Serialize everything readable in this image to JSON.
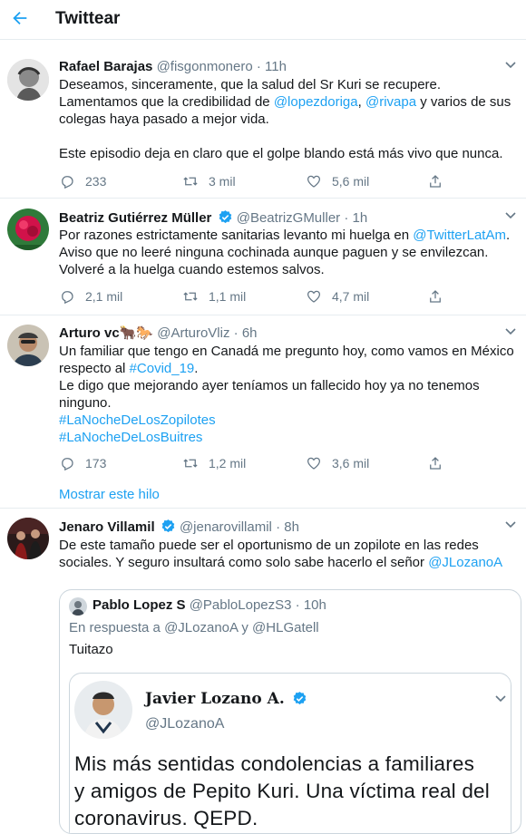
{
  "header": {
    "title": "Twittear"
  },
  "tweets": [
    {
      "name": "Rafael Barajas",
      "handle": "@fisgonmonero",
      "sep": "·",
      "time": "11h",
      "line1": "Deseamos, sinceramente, que la salud del Sr Kuri se recupere.",
      "line2_pre": "Lamentamos que la credibilidad de ",
      "m1": "@lopezdoriga",
      "comma": ", ",
      "m2": "@rivapa",
      "line2_post": " y varios de sus",
      "line3": "colegas haya pasado a mejor vida.",
      "line4": "Este episodio deja en claro que el golpe blando está más vivo que nunca.",
      "reply": "233",
      "retweet": "3 mil",
      "like": "5,6 mil"
    },
    {
      "name": "Beatriz Gutiérrez Müller",
      "handle": "@BeatrizGMuller",
      "sep": "·",
      "time": "1h",
      "line1_pre": "Por razones estrictamente sanitarias levanto mi huelga en ",
      "m1": "@TwitterLatAm",
      "line1_post": ".",
      "line2": "Aviso que no leeré ninguna cochinada aunque paguen y se envilezcan.",
      "line3": "Volveré a la huelga cuando estemos salvos.",
      "reply": "2,1 mil",
      "retweet": "1,1 mil",
      "like": "4,7 mil"
    },
    {
      "name": "Arturo vc🐂🐎",
      "handle": "@ArturoVliz",
      "sep": "·",
      "time": "6h",
      "line1": "Un familiar que tengo en Canadá me pregunto hoy, como vamos en México",
      "line2_pre": "respecto al ",
      "tag1": "#Covid_19",
      "line2_post": ".",
      "line3": "Le digo que mejorando ayer teníamos un fallecido hoy ya no tenemos",
      "line4": "ninguno.",
      "tag2": "#LaNocheDeLosZopilotes",
      "tag3": "#LaNocheDeLosBuitres",
      "reply": "173",
      "retweet": "1,2 mil",
      "like": "3,6 mil"
    },
    {
      "name": "Jenaro Villamil",
      "handle": "@jenarovillamil",
      "sep": "·",
      "time": "8h",
      "line1": "De este tamaño puede ser el oportunismo de un zopilote en las redes",
      "line2_pre": "sociales. Y seguro insultará como solo sabe hacerlo el señor ",
      "m1": "@JLozanoA"
    }
  ],
  "show_thread": "Mostrar este hilo",
  "quote": {
    "name": "Pablo Lopez S",
    "handle": "@PabloLopezS3",
    "sep": "·",
    "time": "10h",
    "reply_prefix": "En respuesta a ",
    "reply_m1": "@JLozanoA",
    "reply_and": " y ",
    "reply_m2": "@HLGatell",
    "text": "Tuitazo",
    "card_name": "Javier Lozano A.",
    "card_handle": "@JLozanoA",
    "card_line1": "Mis más sentidas condolencias a familiares",
    "card_line2": "y amigos de Pepito Kuri. Una víctima real del",
    "card_line3": "coronavirus. QEPD."
  },
  "colors": {
    "accent": "#1da1f2",
    "text": "#14171a",
    "muted": "#657786",
    "border": "#e6ecf0"
  }
}
